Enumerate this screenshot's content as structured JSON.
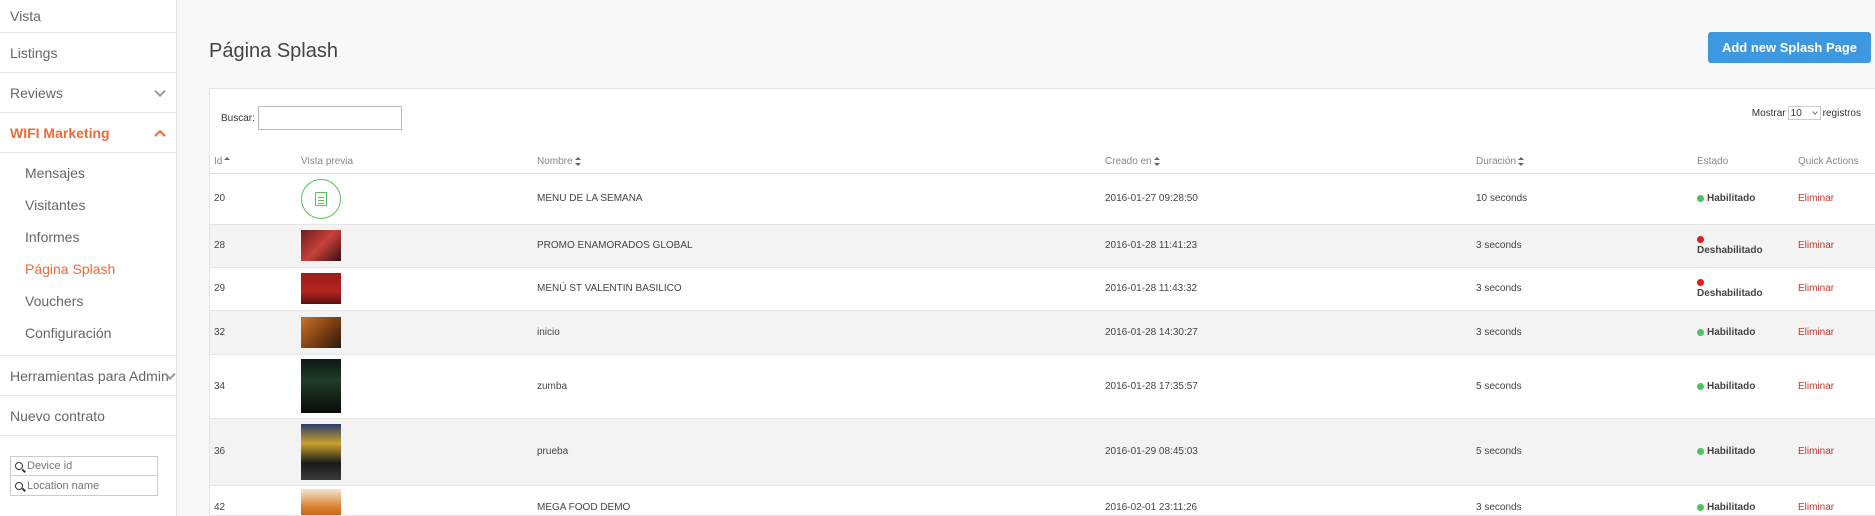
{
  "sidebar": {
    "items": [
      {
        "label": "Vista"
      },
      {
        "label": "Listings"
      },
      {
        "label": "Reviews"
      },
      {
        "label": "WIFI Marketing"
      },
      {
        "label": "Herramientas para Admin"
      },
      {
        "label": "Nuevo contrato"
      }
    ],
    "sub_items": [
      {
        "label": "Mensajes"
      },
      {
        "label": "Visitantes"
      },
      {
        "label": "Informes"
      },
      {
        "label": "Página Splash"
      },
      {
        "label": "Vouchers"
      },
      {
        "label": "Configuración"
      }
    ],
    "device_id_placeholder": "Device id",
    "location_placeholder": "Location name"
  },
  "page": {
    "title": "Página Splash",
    "add_button": "Add new Splash Page"
  },
  "table_controls": {
    "search_label": "Buscar:",
    "show_label": "Mostrar",
    "page_size": "10",
    "records_label": "registros"
  },
  "columns": [
    "Id",
    "Vista previa",
    "Nombre",
    "Creado en",
    "Duración",
    "Estado",
    "Quick Actions"
  ],
  "rows": [
    {
      "id": "20",
      "preview": "document-icon",
      "name": "MENU DE LA SEMANA",
      "created": "2016-01-27 09:28:50",
      "duration": "10 seconds",
      "status": "Habilitado",
      "action": "Eliminar"
    },
    {
      "id": "28",
      "preview": "thumbnail",
      "name": "PROMO ENAMORADOS GLOBAL",
      "created": "2016-01-28 11:41:23",
      "duration": "3 seconds",
      "status": "Deshabilitado",
      "action": "Eliminar"
    },
    {
      "id": "29",
      "preview": "thumbnail",
      "name": "MENÚ ST VALENTIN BASILICO",
      "created": "2016-01-28 11:43:32",
      "duration": "3 seconds",
      "status": "Deshabilitado",
      "action": "Eliminar"
    },
    {
      "id": "32",
      "preview": "thumbnail",
      "name": "inicio",
      "created": "2016-01-28 14:30:27",
      "duration": "3 seconds",
      "status": "Habilitado",
      "action": "Eliminar"
    },
    {
      "id": "34",
      "preview": "thumbnail",
      "name": "zumba",
      "created": "2016-01-28 17:35:57",
      "duration": "5 seconds",
      "status": "Habilitado",
      "action": "Eliminar"
    },
    {
      "id": "36",
      "preview": "thumbnail",
      "name": "prueba",
      "created": "2016-01-29 08:45:03",
      "duration": "5 seconds",
      "status": "Habilitado",
      "action": "Eliminar"
    },
    {
      "id": "42",
      "preview": "thumbnail",
      "name": "MEGA FOOD DEMO",
      "created": "2016-02-01 23:11:26",
      "duration": "3 seconds",
      "status": "Habilitado",
      "action": "Eliminar"
    }
  ],
  "colors": {
    "accent": "#f06a35",
    "primary_button": "#3e98e0",
    "enabled": "#4cc35c",
    "disabled": "#e21d1d",
    "delete_link": "#c0392b"
  }
}
